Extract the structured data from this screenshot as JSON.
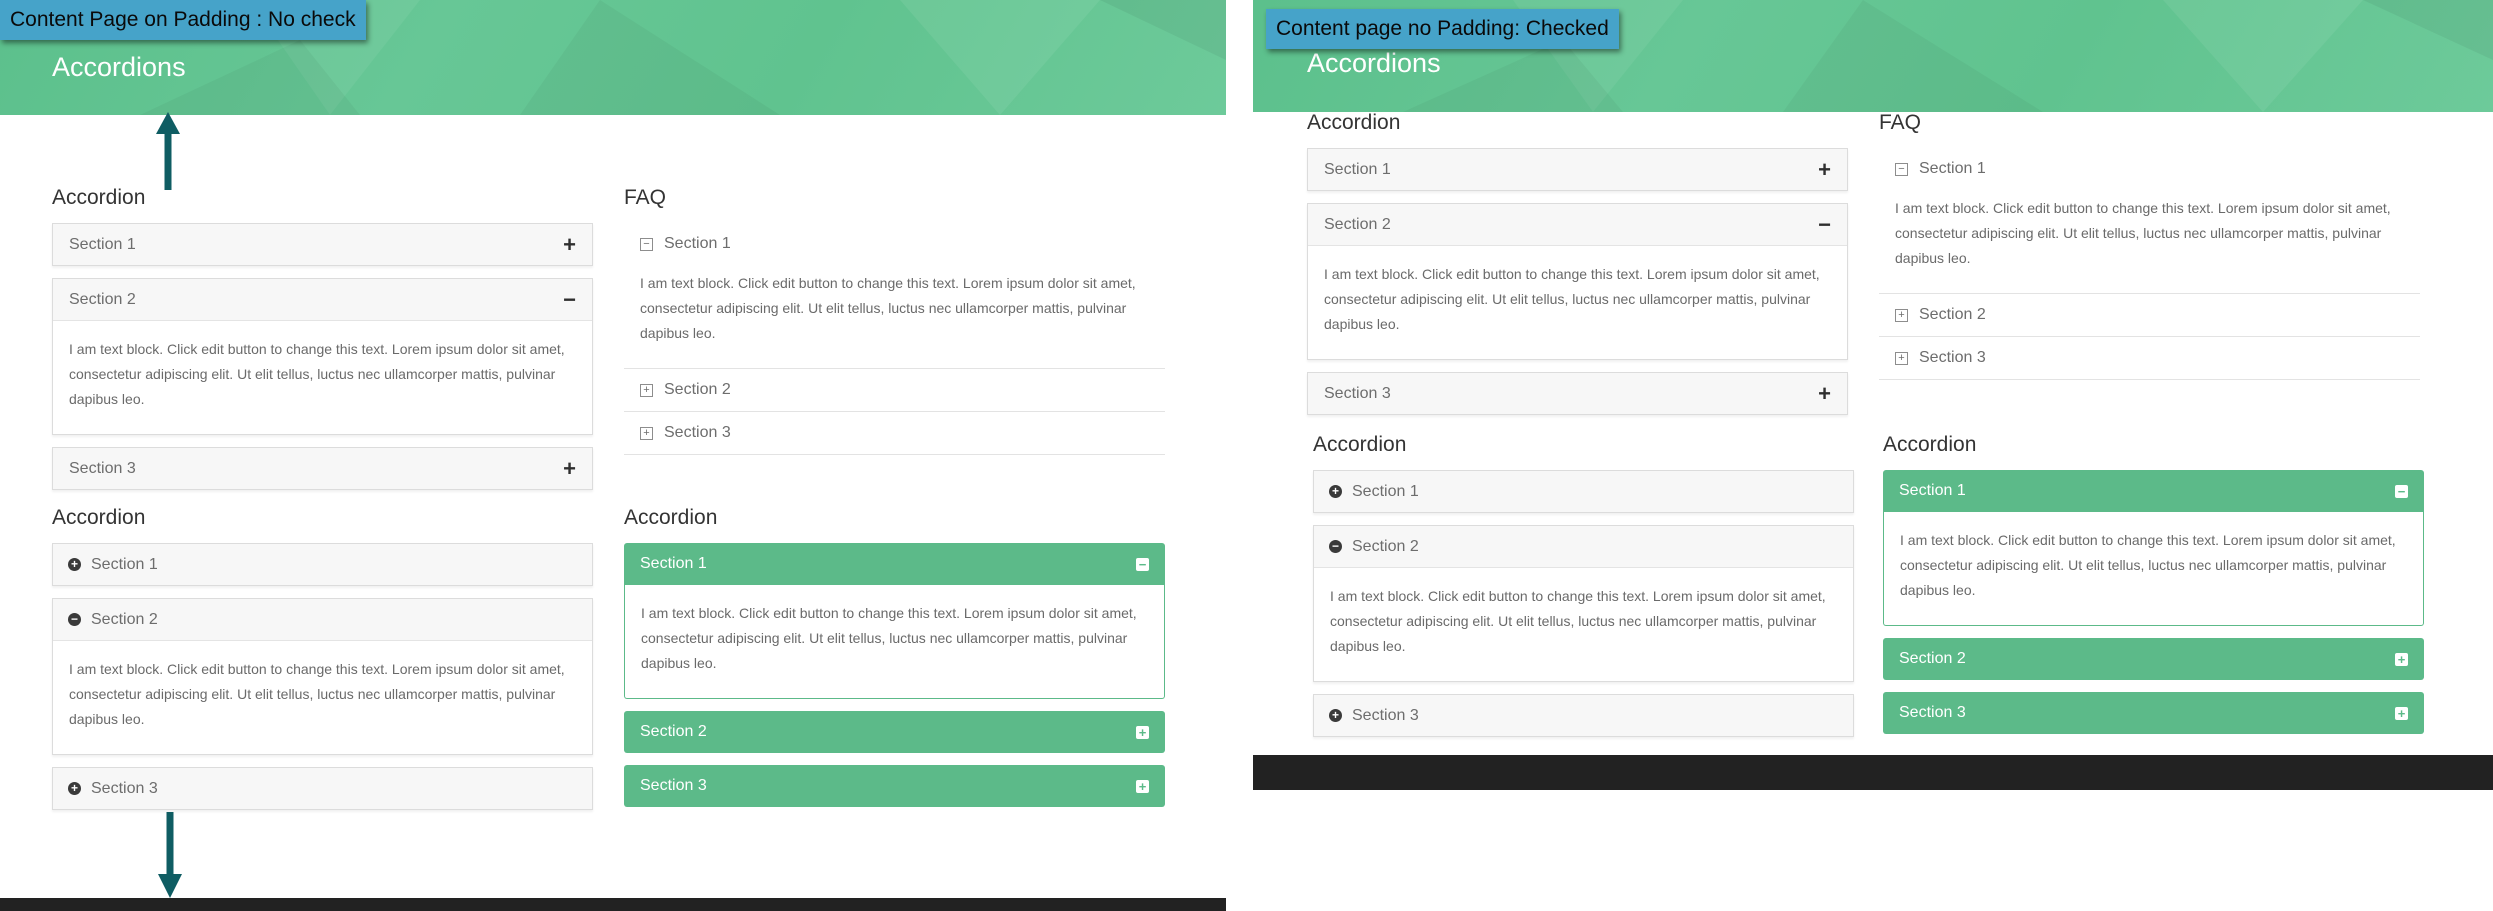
{
  "accent_green": "#5cba89",
  "hero_green": "#64c593",
  "tag_blue": "#46a3c9",
  "footer_color": "#222222",
  "lorem": "I am text block. Click edit button to change this text. Lorem ipsum dolor sit amet, consectetur adipiscing elit. Ut elit tellus, luctus nec ullamcorper mattis, pulvinar dapibus leo.",
  "left": {
    "tag": "Content Page on Padding : No check",
    "hero_title": "Accordions",
    "toggle_widget": {
      "title": "Accordion",
      "items": [
        {
          "label": "Section 1",
          "sign": "+"
        },
        {
          "label": "Section 2",
          "sign": "−"
        },
        {
          "label": "Section 3",
          "sign": "+"
        }
      ]
    },
    "icon_widget": {
      "title": "Accordion",
      "items": [
        {
          "label": "Section 1",
          "sign": "+"
        },
        {
          "label": "Section 2",
          "sign": "−"
        },
        {
          "label": "Section 3",
          "sign": "+"
        }
      ]
    },
    "faq_widget": {
      "title": "FAQ",
      "items": [
        {
          "label": "Section 1",
          "sign": "−"
        },
        {
          "label": "Section 2",
          "sign": "+"
        },
        {
          "label": "Section 3",
          "sign": "+"
        }
      ]
    },
    "green_widget": {
      "title": "Accordion",
      "items": [
        {
          "label": "Section 1",
          "sign": "−"
        },
        {
          "label": "Section 2",
          "sign": "+"
        },
        {
          "label": "Section 3",
          "sign": "+"
        }
      ]
    }
  },
  "right": {
    "tag": "Content page no Padding: Checked",
    "hero_title": "Accordions",
    "toggle_widget": {
      "title": "Accordion",
      "items": [
        {
          "label": "Section 1",
          "sign": "+"
        },
        {
          "label": "Section 2",
          "sign": "−"
        },
        {
          "label": "Section 3",
          "sign": "+"
        }
      ]
    },
    "icon_widget": {
      "title": "Accordion",
      "items": [
        {
          "label": "Section 1",
          "sign": "+"
        },
        {
          "label": "Section 2",
          "sign": "−"
        },
        {
          "label": "Section 3",
          "sign": "+"
        }
      ]
    },
    "faq_widget": {
      "title": "FAQ",
      "items": [
        {
          "label": "Section 1",
          "sign": "−"
        },
        {
          "label": "Section 2",
          "sign": "+"
        },
        {
          "label": "Section 3",
          "sign": "+"
        }
      ]
    },
    "green_widget": {
      "title": "Accordion",
      "items": [
        {
          "label": "Section 1",
          "sign": "−"
        },
        {
          "label": "Section 2",
          "sign": "+"
        },
        {
          "label": "Section 3",
          "sign": "+"
        }
      ]
    }
  }
}
